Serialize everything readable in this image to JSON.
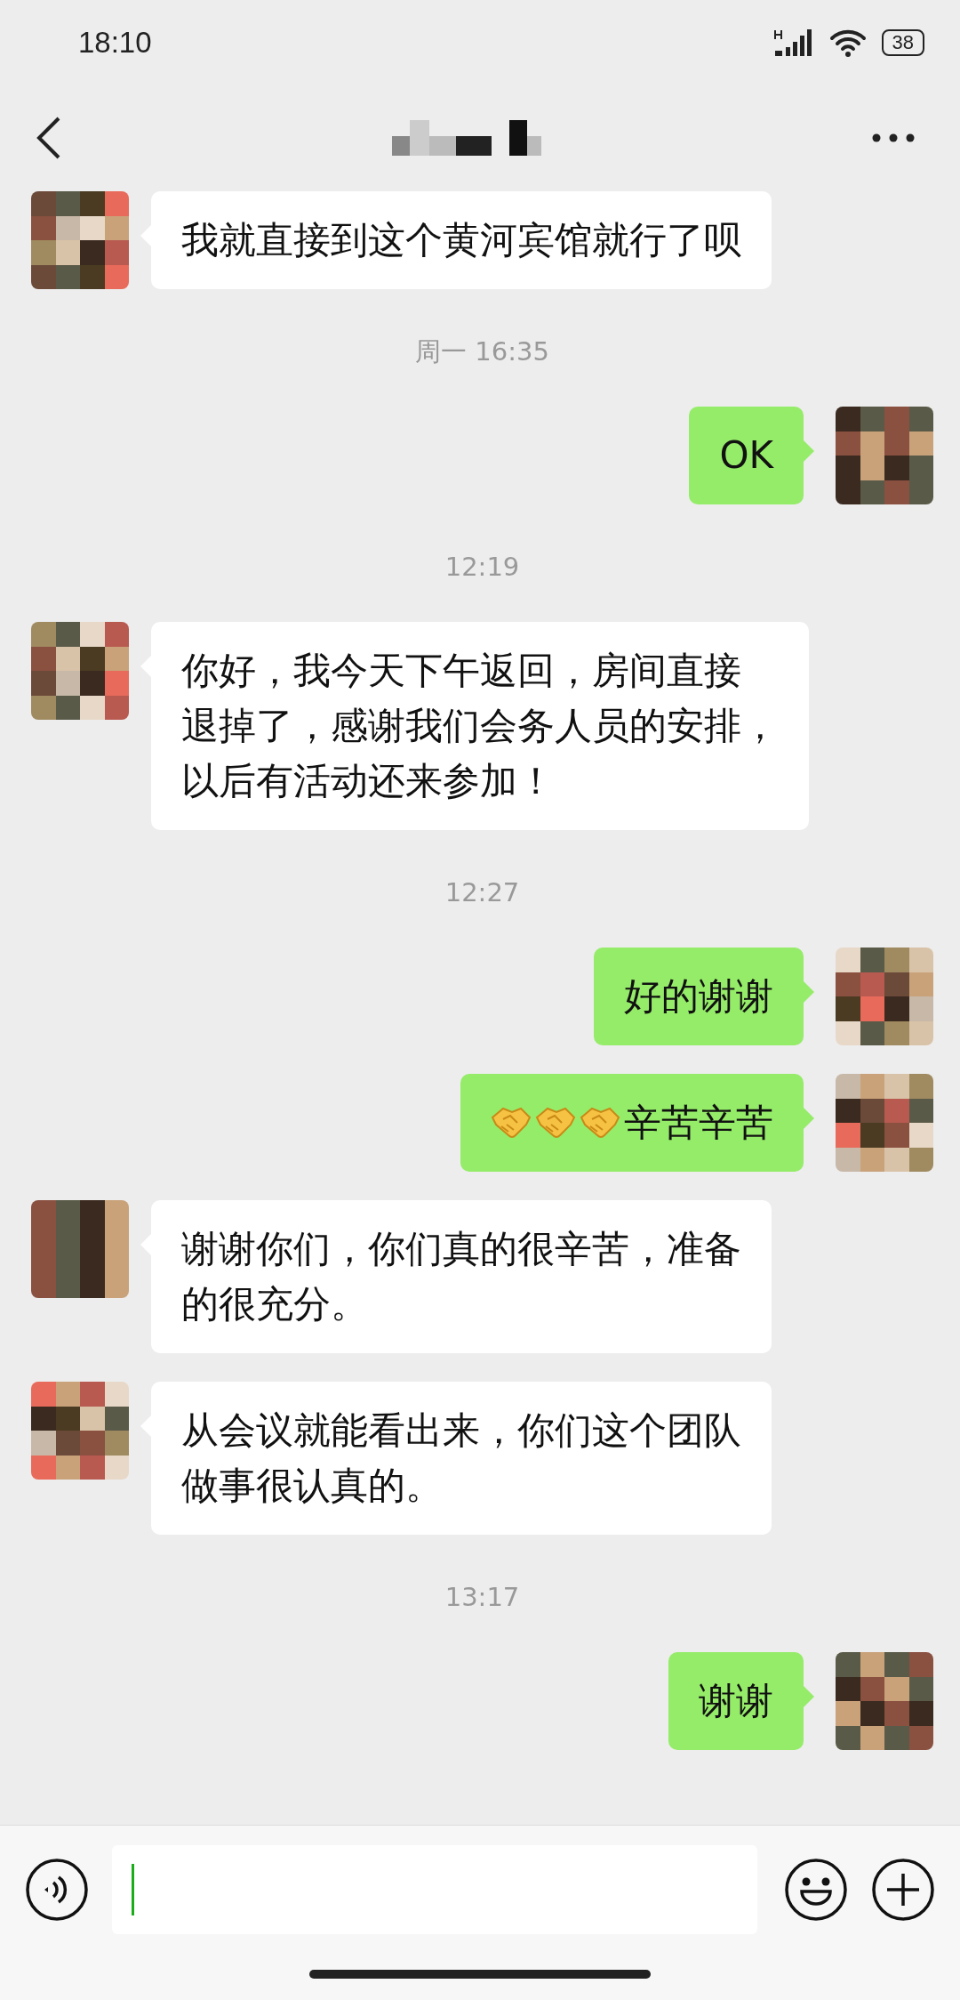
{
  "status_bar": {
    "time": "18:10",
    "battery": "38"
  },
  "messages": [
    {
      "kind": "incoming",
      "lines": [
        "我就直接到这个黄河宾馆就行了呗"
      ]
    },
    {
      "kind": "time",
      "text": "周一 16:35"
    },
    {
      "kind": "outgoing",
      "lines": [
        "OK"
      ]
    },
    {
      "kind": "time",
      "text": "12:19"
    },
    {
      "kind": "incoming",
      "lines": [
        "你好，我今天下午返回，房间直接",
        "退掉了，感谢我们会务人员的安排，",
        "以后有活动还来参加！"
      ]
    },
    {
      "kind": "time",
      "text": "12:27"
    },
    {
      "kind": "outgoing",
      "lines": [
        "好的谢谢"
      ]
    },
    {
      "kind": "outgoing",
      "parts": [
        {
          "kind": "handshake"
        },
        {
          "kind": "handshake"
        },
        {
          "kind": "handshake"
        },
        {
          "kind": "text",
          "text": "辛苦辛苦"
        }
      ]
    },
    {
      "kind": "incoming",
      "lines": [
        "谢谢你们，你们真的很辛苦，准备",
        "的很充分。"
      ]
    },
    {
      "kind": "incoming",
      "lines": [
        "从会议就能看出来，你们这个团队",
        "做事很认真的。"
      ]
    },
    {
      "kind": "time",
      "text": "13:17"
    },
    {
      "kind": "outgoing",
      "lines": [
        "谢谢"
      ]
    }
  ]
}
